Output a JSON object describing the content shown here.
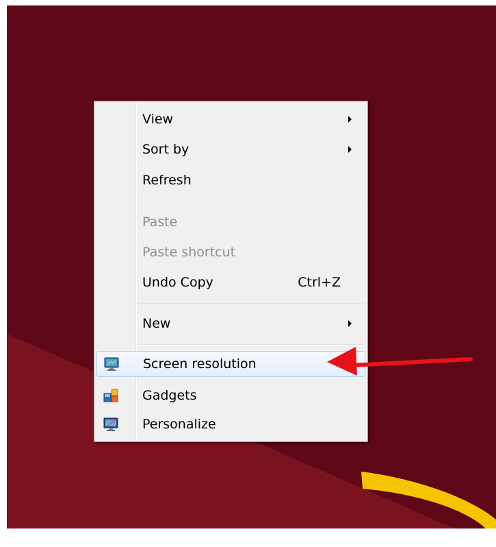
{
  "context_menu": {
    "view_label": "View",
    "sort_by_label": "Sort by",
    "refresh_label": "Refresh",
    "paste_label": "Paste",
    "paste_shortcut_label": "Paste shortcut",
    "undo_copy_label": "Undo Copy",
    "undo_copy_shortcut": "Ctrl+Z",
    "new_label": "New",
    "screen_resolution_label": "Screen resolution",
    "gadgets_label": "Gadgets",
    "personalize_label": "Personalize"
  },
  "icons": {
    "screen_resolution": "monitor-icon",
    "gadgets": "gadgets-icon",
    "personalize": "personalize-monitor-icon",
    "submenu": "submenu-arrow-icon"
  },
  "colors": {
    "desktop_background": "#5e0717",
    "desktop_band": "#7a121f",
    "desktop_swoosh": "#f6c300",
    "menu_background": "#f0f0f0",
    "highlight_border": "#aeccf1",
    "disabled_text": "#8d8d8d",
    "annotation_arrow": "#e8121a"
  }
}
